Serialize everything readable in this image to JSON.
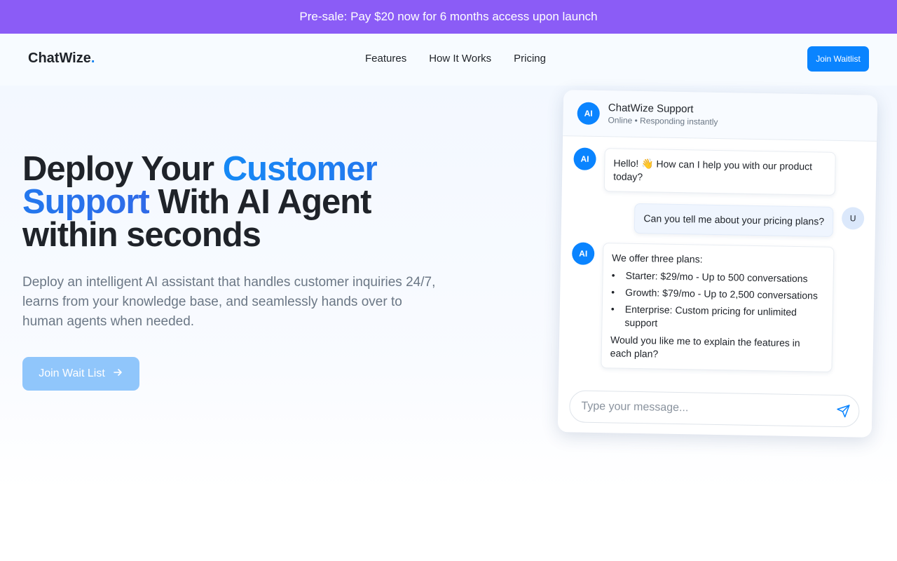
{
  "banner": {
    "text": "Pre-sale: Pay $20 now for 6 months access upon launch"
  },
  "nav": {
    "logo": "ChatWize",
    "logo_dot": ".",
    "links": [
      "Features",
      "How It Works",
      "Pricing"
    ],
    "cta": "Join Waitlist"
  },
  "hero": {
    "title_part1": "Deploy Your ",
    "title_accent": "Customer Support",
    "title_part2": " With AI Agent within seconds",
    "subtitle": "Deploy an intelligent AI assistant that handles customer inquiries 24/7, learns from your knowledge base, and seamlessly hands over to human agents when needed.",
    "cta": "Join Wait List",
    "cta_icon": "arrow-right-icon"
  },
  "chat": {
    "header": {
      "avatar": "AI",
      "name": "ChatWize Support",
      "status": "Online • Responding instantly"
    },
    "messages": [
      {
        "from": "bot",
        "avatar": "AI",
        "text": "Hello! 👋 How can I help you with our product today?"
      },
      {
        "from": "user",
        "avatar": "U",
        "text": "Can you tell me about your pricing plans?"
      },
      {
        "from": "bot",
        "avatar": "AI",
        "intro": "We offer three plans:",
        "plans": [
          "Starter: $29/mo - Up to 500 conversations",
          "Growth: $79/mo - Up to 2,500 conversations",
          "Enterprise: Custom pricing for unlimited support"
        ],
        "outro": "Would you like me to explain the features in each plan?"
      }
    ],
    "input_placeholder": "Type your message...",
    "send_icon": "send-icon"
  },
  "colors": {
    "banner": "#8b5cf6",
    "primary": "#0a84ff",
    "hero_button": "#90c6fb",
    "text": "#1f2329",
    "muted": "#6b7785"
  }
}
